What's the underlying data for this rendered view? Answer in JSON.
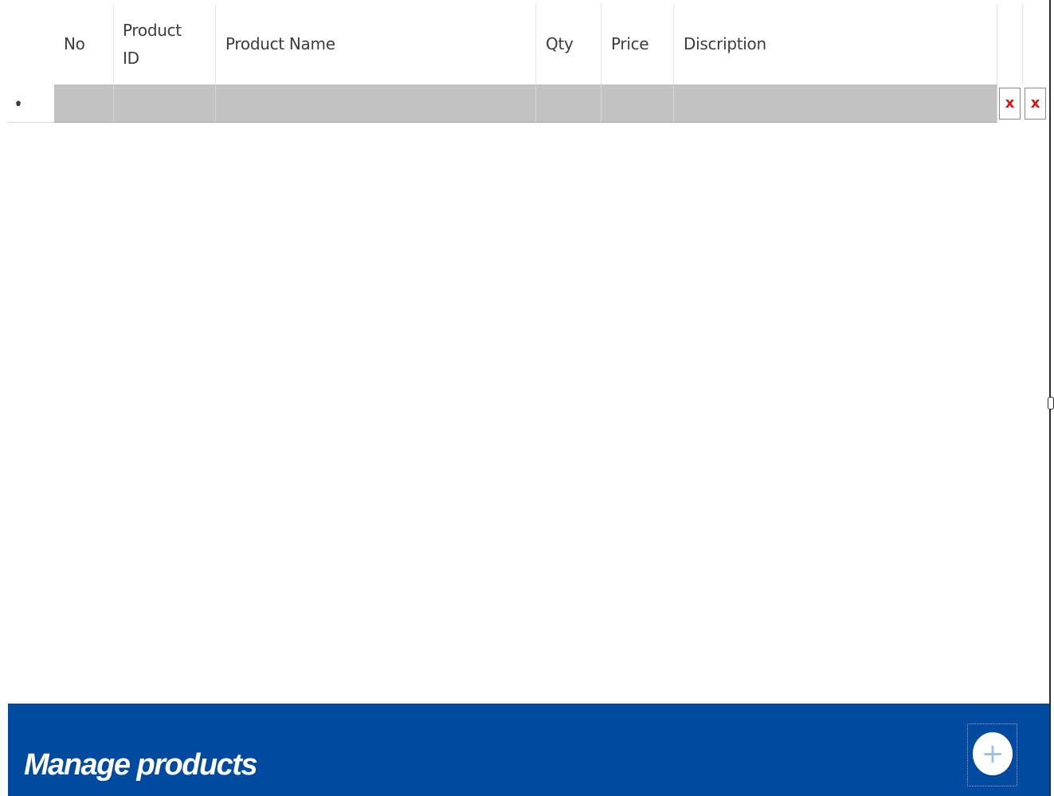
{
  "grid": {
    "columns": [
      {
        "key": "no",
        "label": "No"
      },
      {
        "key": "product_id",
        "label": "Product\nID"
      },
      {
        "key": "product_name",
        "label": "Product Name"
      },
      {
        "key": "qty",
        "label": "Qty"
      },
      {
        "key": "price",
        "label": "Price"
      },
      {
        "key": "description",
        "label": "Discription"
      }
    ],
    "new_row": {
      "indicator_icon": "new-row-asterisk-icon",
      "no": "",
      "product_id": "",
      "product_name": "",
      "qty": "",
      "price": "",
      "description": ""
    },
    "delete_icon": "x",
    "delete_icon_color": "#e01010"
  },
  "footer": {
    "title": "Manage products",
    "add_icon": "+",
    "background_color": "#004aa0"
  }
}
